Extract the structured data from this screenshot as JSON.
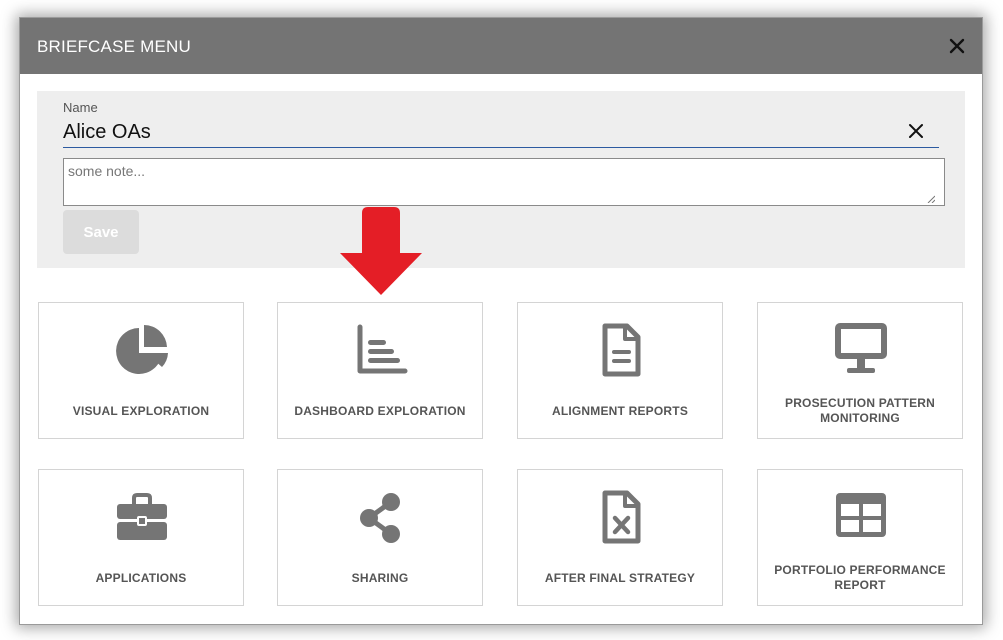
{
  "dialog": {
    "title": "BRIEFCASE MENU",
    "close_icon": "close-icon"
  },
  "form": {
    "name_label": "Name",
    "name_value": "Alice OAs",
    "note_placeholder": "some note...",
    "save_label": "Save"
  },
  "tiles": [
    {
      "label": "VISUAL EXPLORATION",
      "icon": "pie-chart-icon"
    },
    {
      "label": "DASHBOARD EXPLORATION",
      "icon": "bar-chart-icon"
    },
    {
      "label": "ALIGNMENT REPORTS",
      "icon": "document-icon"
    },
    {
      "label": "PROSECUTION PATTERN MONITORING",
      "icon": "monitor-icon"
    },
    {
      "label": "APPLICATIONS",
      "icon": "briefcase-icon"
    },
    {
      "label": "SHARING",
      "icon": "share-icon"
    },
    {
      "label": "AFTER FINAL STRATEGY",
      "icon": "file-excel-icon"
    },
    {
      "label": "PORTFOLIO PERFORMANCE REPORT",
      "icon": "table-icon"
    }
  ],
  "colors": {
    "titlebar": "#747474",
    "icon": "#757575",
    "arrow": "#e41e26",
    "input_underline": "#2c5aa0"
  }
}
